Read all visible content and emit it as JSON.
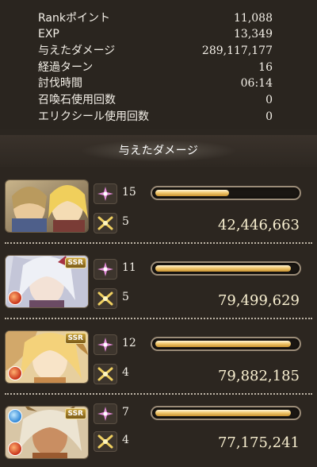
{
  "stats": [
    {
      "label": "Rankポイント",
      "value": "11,088"
    },
    {
      "label": "EXP",
      "value": "13,349"
    },
    {
      "label": "与えたダメージ",
      "value": "289,117,177"
    },
    {
      "label": "経過ターン",
      "value": "16"
    },
    {
      "label": "討伐時間",
      "value": "06:14"
    },
    {
      "label": "召喚石使用回数",
      "value": "0"
    },
    {
      "label": "エリクシール使用回数",
      "value": "0"
    }
  ],
  "section_title": "与えたダメージ",
  "parties": [
    {
      "hits": "15",
      "charge_bar_fraction": 0.52,
      "skills": "5",
      "damage": "42,446,663",
      "ssr_label": "",
      "element_icon": "none"
    },
    {
      "hits": "11",
      "charge_bar_fraction": 0.96,
      "skills": "5",
      "damage": "79,499,629",
      "ssr_label": "SSR",
      "element_icon": "fire-element-icon"
    },
    {
      "hits": "12",
      "charge_bar_fraction": 0.96,
      "skills": "4",
      "damage": "79,882,185",
      "ssr_label": "SSR",
      "element_icon": "fire-element-icon"
    },
    {
      "hits": "7",
      "charge_bar_fraction": 0.96,
      "skills": "4",
      "damage": "77,175,241",
      "ssr_label": "SSR",
      "element_icon": "water-and-fire-element-icons"
    }
  ],
  "colors": {
    "background": "#2b2620",
    "bar_fill": "#f2c970",
    "attack_icon": "#e08ad6",
    "skill_icon": "#f0d060",
    "divider": "#bdb4a6"
  },
  "icons": {
    "hit_icon": "sparkle-icon",
    "skill_icon": "crossed-swords-icon"
  }
}
